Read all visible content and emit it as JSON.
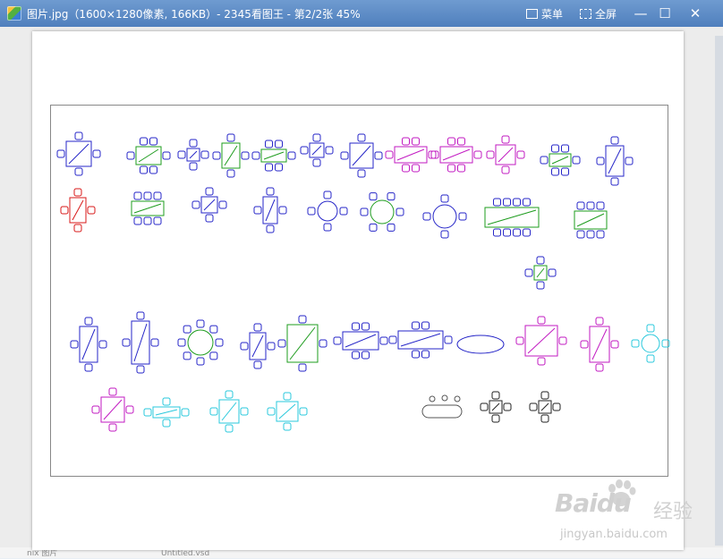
{
  "window": {
    "title": "图片.jpg（1600×1280像素, 166KB）- 2345看图王 - 第2/2张 45%",
    "menu_label": "菜单",
    "fullscreen_label": "全屏",
    "minimize_symbol": "—",
    "maximize_symbol": "☐",
    "close_symbol": "✕"
  },
  "background_strip": {
    "left_text": "nix 图片",
    "middle_text": "Untitled.vsd"
  },
  "watermark": {
    "brand": "Baidu",
    "cn": "经验",
    "url": "jingyan.baidu.com"
  },
  "colors": {
    "titlebar": "#5a88c5",
    "blue": "#2626c8",
    "green": "#1e9c1e",
    "magenta": "#c21ac2",
    "red": "#d81818",
    "cyan": "#28c8dc",
    "black": "#222222"
  },
  "icons": [
    "app-icon",
    "menu-icon",
    "fullscreen-icon",
    "minimize-icon",
    "maximize-icon",
    "close-icon"
  ]
}
